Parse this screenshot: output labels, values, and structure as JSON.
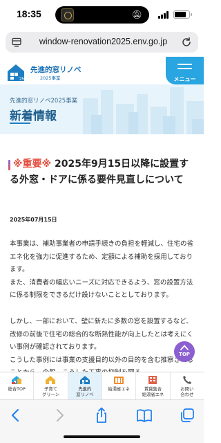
{
  "status_bar": {
    "time": "18:35"
  },
  "url_bar": {
    "url": "window-renovation2025.env.go.jp"
  },
  "site_header": {
    "logo_title": "先進的窓リノベ",
    "logo_subtitle": "2025事業",
    "logo_year_badge": "'25",
    "menu_label": "メニュー"
  },
  "page_hero": {
    "breadcrumb": "先進的窓リノベ2025事業",
    "title": "新着情報"
  },
  "article": {
    "important_tag": "※重要※",
    "title": "2025年9月15日以降に設置する外窓・ドアに係る要件見直しについて",
    "date": "2025年07月15日",
    "paragraphs": [
      "本事業は、補助事業者の申請手続きの負担を軽減し、住宅の省エネ化を強力に促進するため、定額による補助を採用しております。\nまた、消費者の幅広いニーズに対応できるよう、窓の設置方法に係る制限をできるだけ設けないこととしております。",
      "しかし、一部において、壁に新たに多数の窓を設置するなど、改修の前後で住宅の総合的な断熱性能が向上したとは考えにくい事例が確認されております。\nこうした事例には事業の支援目的以外の目的を含む推察されることから、今般、こうした工事の抑制を図る"
    ]
  },
  "top_button": {
    "label": "TOP"
  },
  "site_nav": {
    "items": [
      {
        "label": "総合TOP",
        "icon": "house-icon"
      },
      {
        "label": "子育て\nグリーン",
        "icon": "family-house-icon"
      },
      {
        "label": "先進的\n窓リノベ",
        "icon": "window-house-icon"
      },
      {
        "label": "給湯省エネ",
        "icon": "water-heater-icon"
      },
      {
        "label": "賃貸集合\n給湯省エネ",
        "icon": "apartment-icon"
      },
      {
        "label": "お問い\n合わせ",
        "icon": "phone-icon"
      }
    ]
  },
  "colors": {
    "brand_blue": "#29a5e1",
    "title_blue": "#1f5f8f",
    "important_red": "#e3483a",
    "top_button_purple": "#8c5fd0"
  }
}
